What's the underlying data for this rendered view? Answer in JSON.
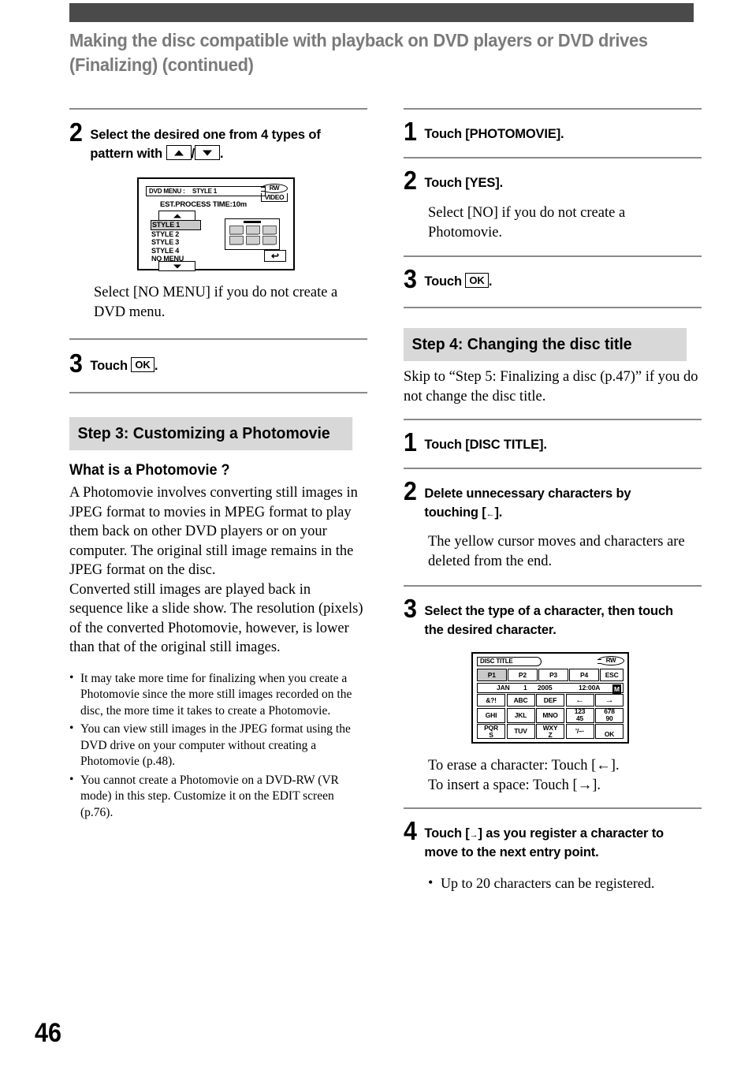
{
  "header": {
    "title": "Making the disc compatible with playback on DVD players or DVD drives (Finalizing) (continued)",
    "bar_color": "#4a4a4a",
    "title_color": "#7a7a7a"
  },
  "page_number": "46",
  "left_column": {
    "step2": {
      "number": "2",
      "text_before": "Select the desired one from 4 types of pattern with ",
      "text_between": "/",
      "text_after": "."
    },
    "dvd_menu_screen": {
      "title_label": "DVD MENU :",
      "title_value": "STYLE 1",
      "disc_type": "RW",
      "disc_mode": "VIDEO",
      "est_time": "EST.PROCESS TIME:10m",
      "list": [
        "STYLE 1",
        "STYLE 2",
        "STYLE 3",
        "STYLE 4",
        "NO MENU"
      ],
      "selected": "STYLE 1",
      "up_arrow_icon": "up-triangle",
      "down_arrow_icon": "down-triangle",
      "return_icon": "return-arrow"
    },
    "note_after_step2": "Select [NO MENU] if you do not create a DVD menu.",
    "step3": {
      "number": "3",
      "text_before": "Touch ",
      "key": "OK",
      "text_after": "."
    },
    "section_heading": "Step 3: Customizing a Photomovie",
    "sub_heading": "What is a Photomovie ?",
    "paragraphs": [
      "A Photomovie involves converting still images in JPEG format to movies in MPEG format to play them back on other DVD players or on your computer. The original still image remains in the JPEG format on the disc.",
      "Converted still images are played back in sequence like a slide show. The resolution (pixels) of the converted Photomovie, however, is lower than that of the original still images."
    ],
    "bullets": [
      "It may take more time for finalizing when you create a Photomovie since the more still images recorded on the disc, the more time it takes to create a Photomovie.",
      "You can view still images in the JPEG format using the DVD drive on your computer without creating a Photomovie (p.48).",
      "You cannot create a Photomovie on a DVD-RW (VR mode) in this step. Customize it on the EDIT screen (p.76)."
    ]
  },
  "right_column": {
    "step1": {
      "number": "1",
      "text": "Touch [PHOTOMOVIE]."
    },
    "step2": {
      "number": "2",
      "text": "Touch [YES]."
    },
    "step2_note": "Select [NO] if you do not create a Photomovie.",
    "step3": {
      "number": "3",
      "text_before": "Touch ",
      "key": "OK",
      "text_after": "."
    },
    "section_heading": "Step 4: Changing the disc title",
    "intro": "Skip to “Step 5: Finalizing a disc (p.47)” if you do not change the disc title.",
    "step4_1": {
      "number": "1",
      "text": "Touch [DISC TITLE]."
    },
    "step4_2": {
      "number": "2",
      "text_before": "Delete unnecessary characters by touching [",
      "arrow": "←",
      "text_after": "]."
    },
    "step4_2_note": "The yellow cursor moves and characters are deleted from the end.",
    "step4_3": {
      "number": "3",
      "text": "Select the type of a character, then touch the desired character."
    },
    "disc_title_screen": {
      "title_label": "DISC TITLE",
      "disc_type": "RW",
      "page_tabs": [
        "P1",
        "P2",
        "P3",
        "P4"
      ],
      "selected_tab": "P1",
      "esc_label": "ESC",
      "date": {
        "month": "JAN",
        "day": "1",
        "year": "2005",
        "time": "12:00A",
        "cursor_char": "M"
      },
      "keys": [
        [
          "&?!",
          "ABC",
          "DEF",
          "←",
          "→"
        ],
        [
          "GHI",
          "JKL",
          "123\n45",
          "678\n90"
        ],
        [
          "PQR\nS",
          "TUV",
          "WXY\nZ",
          "’/–·",
          "OK"
        ]
      ],
      "row2": [
        "GHI",
        "JKL",
        "MNO",
        "123\n45",
        "678\n90"
      ],
      "ok_label": "OK"
    },
    "erase_line": "To erase a character: Touch [←].",
    "insert_line": "To insert a space: Touch [→].",
    "step4_4": {
      "number": "4",
      "text_before": "Touch [",
      "arrow": "→",
      "text_after": "] as you register a character to move to the next entry point."
    },
    "step4_4_bullet": "Up to 20 characters can be registered."
  }
}
